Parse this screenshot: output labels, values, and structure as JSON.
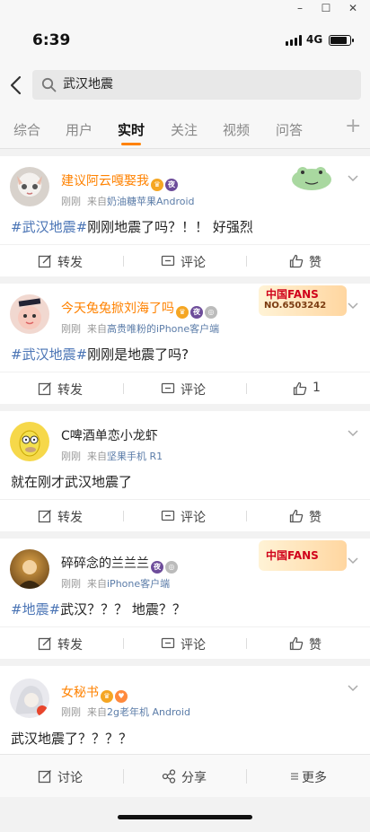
{
  "window": {
    "minimize": "–",
    "maximize": "☐",
    "close": "✕"
  },
  "status": {
    "time": "6:39",
    "network": "4G",
    "battery_level": 0.9
  },
  "search": {
    "query": "武汉地震"
  },
  "tabs": [
    {
      "label": "综合"
    },
    {
      "label": "用户"
    },
    {
      "label": "实时",
      "active": true
    },
    {
      "label": "关注"
    },
    {
      "label": "视频"
    },
    {
      "label": "问答"
    }
  ],
  "tab_add": "+",
  "posts": [
    {
      "user": "建议阿云嘎娶我",
      "time": "刚刚",
      "source_prefix": "来自",
      "source": "奶油糖苹果Android",
      "hashtag": "#武汉地震#",
      "text": "刚刚地震了吗？！！ 好强烈",
      "repost": "转发",
      "comment": "评论",
      "like": "赞"
    },
    {
      "user": "今天兔兔掀刘海了吗",
      "time": "刚刚",
      "source_prefix": "来自",
      "source": "高贵唯粉的iPhone客户端",
      "hashtag": "#武汉地震#",
      "text": "刚刚是地震了吗?",
      "fans_title": "中国FANS",
      "fans_no": "NO.6503242",
      "repost": "转发",
      "comment": "评论",
      "like": "1"
    },
    {
      "user": "C啤酒单恋小龙虾",
      "time": "刚刚",
      "source_prefix": "来自",
      "source": "坚果手机 R1",
      "hashtag": "",
      "text": "就在刚才武汉地震了",
      "repost": "转发",
      "comment": "评论",
      "like": "赞"
    },
    {
      "user": "碎碎念的兰兰兰",
      "time": "刚刚",
      "source_prefix": "来自",
      "source": "iPhone客户端",
      "hashtag": "#地震#",
      "text": "武汉？？？ 地震？？",
      "fans_title": "中国FANS",
      "repost": "转发",
      "comment": "评论",
      "like": "赞"
    },
    {
      "user": "女秘书",
      "time": "刚刚",
      "source_prefix": "来自",
      "source": "2g老年机 Android",
      "hashtag": "",
      "text": "武汉地震了？？？？"
    }
  ],
  "bottom_bar": {
    "discuss": "讨论",
    "share": "分享",
    "more": "更多"
  },
  "colors": {
    "accent": "#ff8200",
    "link": "#4a74b5",
    "source": "#5b7ca8"
  }
}
